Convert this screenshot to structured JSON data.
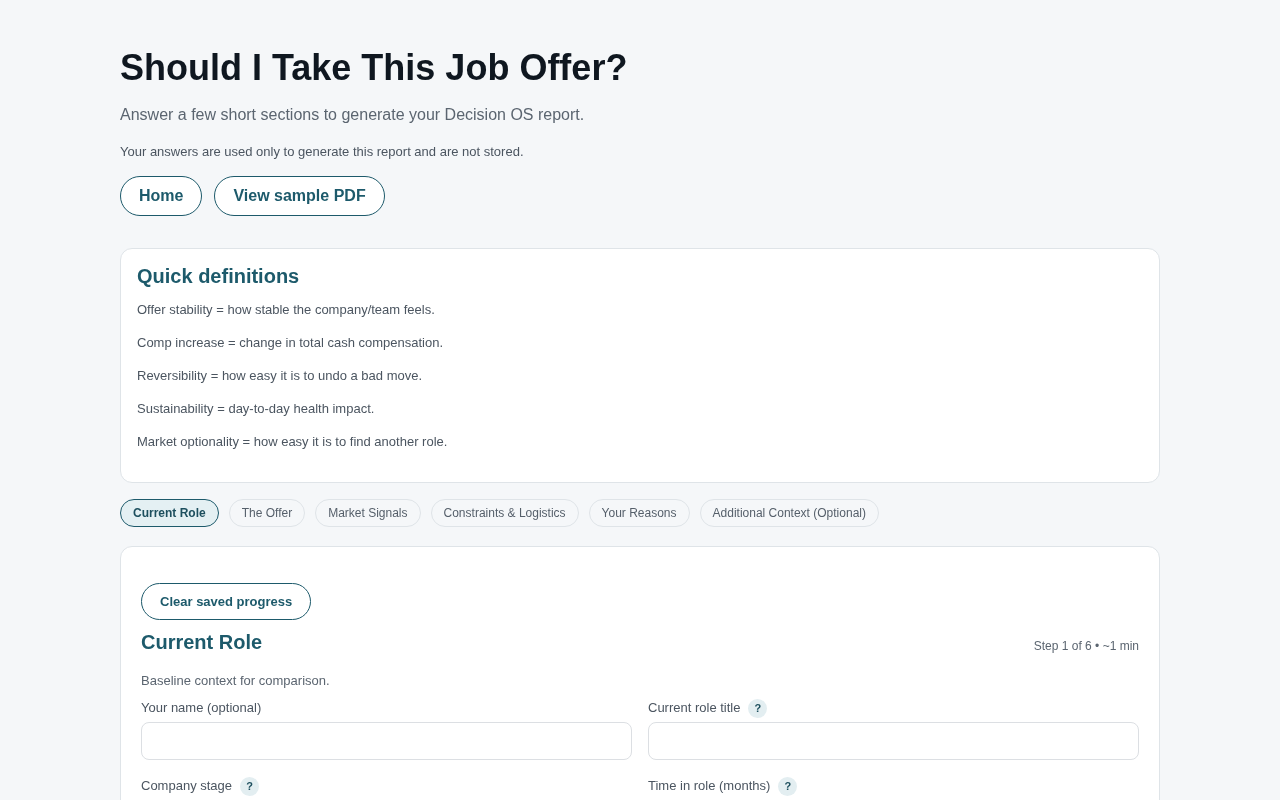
{
  "header": {
    "title": "Should I Take This Job Offer?",
    "subtitle": "Answer a few short sections to generate your Decision OS report.",
    "privacy_note": "Your answers are used only to generate this report and are not stored."
  },
  "nav_buttons": [
    "Home",
    "View sample PDF"
  ],
  "definitions": {
    "title": "Quick definitions",
    "items": [
      "Offer stability = how stable the company/team feels.",
      "Comp increase = change in total cash compensation.",
      "Reversibility = how easy it is to undo a bad move.",
      "Sustainability = day-to-day health impact.",
      "Market optionality = how easy it is to find another role."
    ]
  },
  "tabs": [
    {
      "label": "Current Role",
      "selected": true
    },
    {
      "label": "The Offer",
      "selected": false
    },
    {
      "label": "Market Signals",
      "selected": false
    },
    {
      "label": "Constraints & Logistics",
      "selected": false
    },
    {
      "label": "Your Reasons",
      "selected": false
    },
    {
      "label": "Additional Context (Optional)",
      "selected": false
    }
  ],
  "form": {
    "clear_button": "Clear saved progress",
    "title": "Current Role",
    "step_info": "Step 1 of 6 • ~1 min",
    "description": "Baseline context for comparison.",
    "fields": [
      {
        "label": "Your name (optional)",
        "kind": "input"
      },
      {
        "label": "Current role title",
        "help": "?",
        "kind": "input"
      },
      {
        "label": "Company stage",
        "help": "?",
        "kind": "label_only"
      },
      {
        "label": "Time in role (months)",
        "help": "?",
        "kind": "label_only"
      }
    ]
  }
}
